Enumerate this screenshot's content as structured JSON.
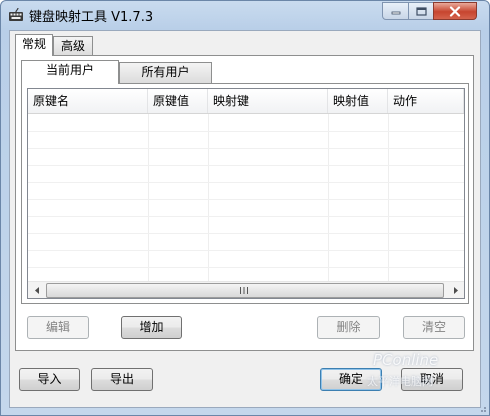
{
  "window": {
    "title": "键盘映射工具 V1.7.3",
    "icon": "keyboard-icon",
    "controls": [
      "minimize-icon",
      "maximize-icon",
      "close-icon"
    ]
  },
  "outer_tabs": [
    {
      "label": "常规",
      "active": true
    },
    {
      "label": "高级",
      "active": false
    }
  ],
  "inner_tabs": [
    {
      "label": "当前用户",
      "active": true
    },
    {
      "label": "所有用户",
      "active": false
    }
  ],
  "list": {
    "columns": [
      "原键名",
      "原键值",
      "映射键",
      "映射值",
      "动作"
    ],
    "rows": []
  },
  "list_buttons": {
    "edit": "编辑",
    "add": "增加",
    "delete": "删除",
    "clear": "清空"
  },
  "footer_buttons": {
    "import": "导入",
    "export": "导出",
    "ok": "确定",
    "cancel": "取消"
  },
  "watermark": {
    "brand": "PConline",
    "sub": "太平洋电脑网"
  },
  "colors": {
    "titlebar": "#b9cfe8",
    "close_button": "#c7452f",
    "default_button_border": "#3c7fb1"
  }
}
